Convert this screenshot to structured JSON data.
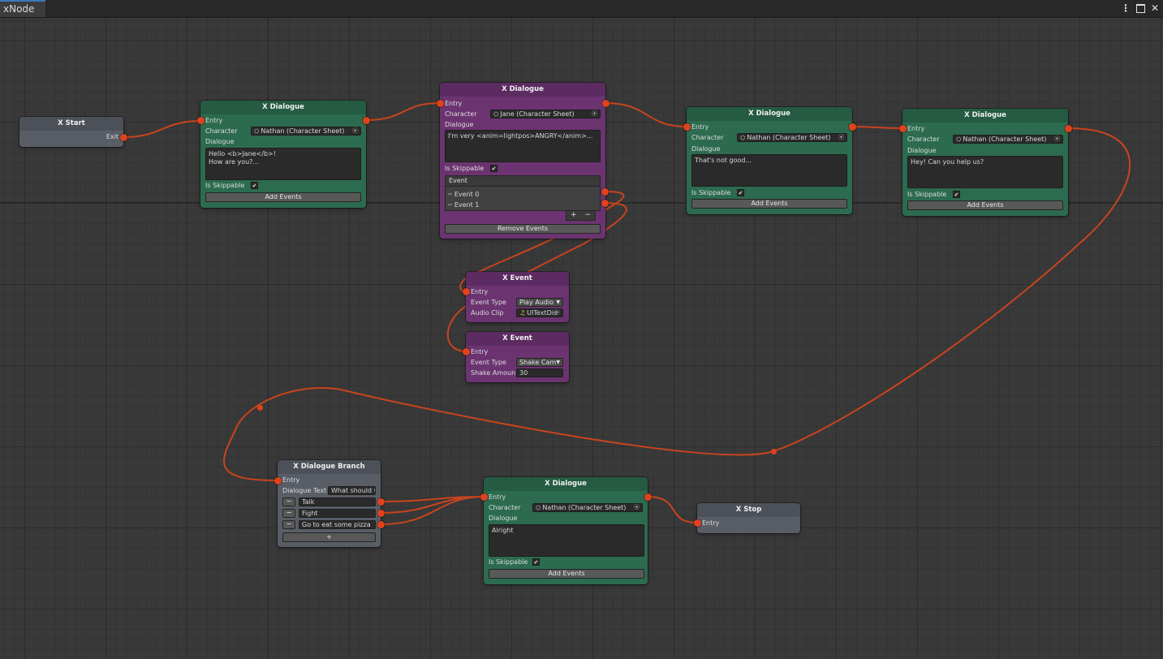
{
  "window": {
    "tab_title": "xNode",
    "menu_icon": "kebab-menu-icon",
    "maximize_icon": "maximize-icon",
    "close_label": "✕"
  },
  "colors": {
    "canvas": "#393939",
    "dialogue_node": "#2c6b4f",
    "event_node": "#6b3471",
    "control_node": "#585d66",
    "port": "#e0421d",
    "wire": "#c8441e"
  },
  "nodes": {
    "start": {
      "title": "X Start",
      "exit_label": "Exit"
    },
    "dialogue1": {
      "title": "X Dialogue",
      "entry_label": "Entry",
      "character_label": "Character",
      "character_value": "Nathan (Character Sheet)",
      "dialogue_label": "Dialogue",
      "dialogue_text": "Hello <b>Jane</b>!\nHow are you?...",
      "skippable_label": "Is Skippable",
      "skippable": "✔",
      "button_label": "Add Events"
    },
    "dialogue2": {
      "title": "X Dialogue",
      "entry_label": "Entry",
      "character_label": "Character",
      "character_value": "Jane (Character Sheet)",
      "dialogue_label": "Dialogue",
      "dialogue_text": "I'm very <anim=lightpos>ANGRY</anim>...",
      "skippable_label": "Is Skippable",
      "skippable": "✔",
      "events_header": "Event",
      "events": [
        "Event 0",
        "Event 1"
      ],
      "list_add": "+",
      "list_remove": "−",
      "button_label": "Remove Events"
    },
    "dialogue3": {
      "title": "X Dialogue",
      "entry_label": "Entry",
      "character_label": "Character",
      "character_value": "Nathan (Character Sheet)",
      "dialogue_label": "Dialogue",
      "dialogue_text": "That's not good...",
      "skippable_label": "Is Skippable",
      "skippable": "✔",
      "button_label": "Add Events"
    },
    "dialogue4": {
      "title": "X Dialogue",
      "entry_label": "Entry",
      "character_label": "Character",
      "character_value": "Nathan (Character Sheet)",
      "dialogue_label": "Dialogue",
      "dialogue_text": "Hey! Can you help us?",
      "skippable_label": "Is Skippable",
      "skippable": "✔",
      "button_label": "Add Events"
    },
    "event1": {
      "title": "X Event",
      "entry_label": "Entry",
      "type_label": "Event Type",
      "type_value": "Play Audio",
      "param_label": "Audio Clip",
      "param_value": "UITextDis"
    },
    "event2": {
      "title": "X Event",
      "entry_label": "Entry",
      "type_label": "Event Type",
      "type_value": "Shake Cam",
      "param_label": "Shake Amoun",
      "param_value": "30"
    },
    "branch": {
      "title": "X Dialogue Branch",
      "entry_label": "Entry",
      "text_label": "Dialogue Text",
      "text_value": "What should w",
      "options": [
        "Talk",
        "Fight",
        "Go to eat some pizza"
      ],
      "remove_label": "−",
      "add_label": "+"
    },
    "dialogue5": {
      "title": "X Dialogue",
      "entry_label": "Entry",
      "character_label": "Character",
      "character_value": "Nathan (Character Sheet)",
      "dialogue_label": "Dialogue",
      "dialogue_text": "Alright",
      "skippable_label": "Is Skippable",
      "skippable": "✔",
      "button_label": "Add Events"
    },
    "stop": {
      "title": "X Stop",
      "entry_label": "Entry"
    }
  }
}
